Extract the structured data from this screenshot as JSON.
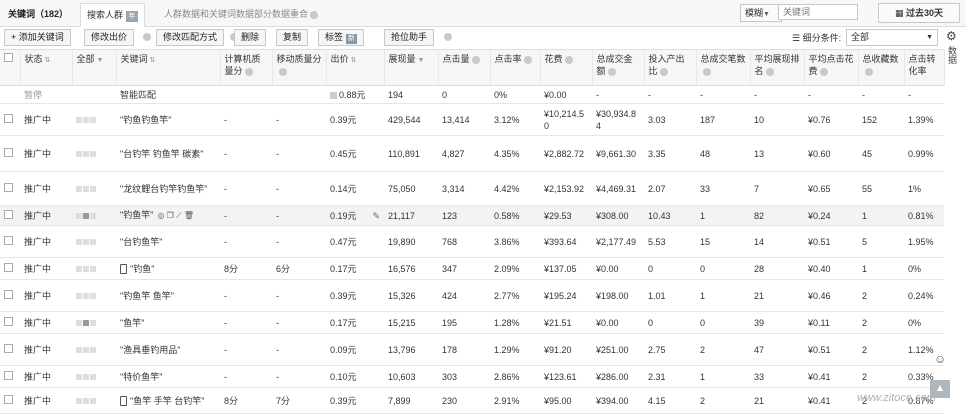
{
  "tabs": {
    "keywords": "关键词（182）",
    "search_crowd": "搜索人群",
    "badge": "年",
    "note": "人群数据和关键词数据部分数据重合"
  },
  "search": {
    "mode": "模糊",
    "placeholder": "关键词"
  },
  "date_range": "过去30天",
  "toolbar": {
    "add_keyword": "+ 添加关键词",
    "edit_price": "修改出价",
    "edit_match": "修改匹配方式",
    "delete": "删除",
    "copy": "复制",
    "tag": "标签",
    "tag_badge": "新",
    "rank_helper": "抢位助手",
    "filter_label": "细分条件:",
    "filter_value": "全部"
  },
  "side_tab": "数据",
  "columns": [
    "状态",
    "全部",
    "关键词",
    "计算机质量分",
    "移动质量分",
    "出价",
    "展现量",
    "点击量",
    "点击率",
    "花费",
    "总成交金额",
    "投入产出比",
    "总成交笔数",
    "平均展现排名",
    "平均点击花费",
    "总收藏数",
    "点击转化率"
  ],
  "rows": [
    {
      "status": "暂停",
      "kw": "智能匹配",
      "pc": "",
      "mobile": "",
      "bid": "0.88元",
      "impr": "194",
      "clicks": "0",
      "ctr": "0%",
      "cost": "¥0.00",
      "gmv": "-",
      "roi": "-",
      "orders": "-",
      "rank": "-",
      "cpc": "-",
      "fav": "-",
      "cvr": "-"
    },
    {
      "status": "推广中",
      "kw": "\"钓鱼钓鱼竿\"",
      "pc": "-",
      "mobile": "-",
      "bid": "0.39元",
      "impr": "429,544",
      "clicks": "13,414",
      "ctr": "3.12%",
      "cost": "¥10,214.50",
      "gmv": "¥30,934.84",
      "roi": "3.03",
      "orders": "187",
      "rank": "10",
      "cpc": "¥0.76",
      "fav": "152",
      "cvr": "1.39%"
    },
    {
      "status": "推广中",
      "kw": "\"台钓竿 钓鱼竿 碳素\"",
      "pc": "-",
      "mobile": "-",
      "bid": "0.45元",
      "impr": "110,891",
      "clicks": "4,827",
      "ctr": "4.35%",
      "cost": "¥2,882.72",
      "gmv": "¥9,661.30",
      "roi": "3.35",
      "orders": "48",
      "rank": "13",
      "cpc": "¥0.60",
      "fav": "45",
      "cvr": "0.99%"
    },
    {
      "status": "推广中",
      "kw": "\"龙纹鲤台钓竿钓鱼竿\"",
      "pc": "-",
      "mobile": "-",
      "bid": "0.14元",
      "impr": "75,050",
      "clicks": "3,314",
      "ctr": "4.42%",
      "cost": "¥2,153.92",
      "gmv": "¥4,469.31",
      "roi": "2.07",
      "orders": "33",
      "rank": "7",
      "cpc": "¥0.65",
      "fav": "55",
      "cvr": "1%"
    },
    {
      "status": "推广中",
      "kw": "\"钓鱼竿\"",
      "pc": "-",
      "mobile": "-",
      "bid": "0.19元",
      "impr": "21,117",
      "clicks": "123",
      "ctr": "0.58%",
      "cost": "¥29.53",
      "gmv": "¥308.00",
      "roi": "10.43",
      "orders": "1",
      "rank": "82",
      "cpc": "¥0.24",
      "fav": "1",
      "cvr": "0.81%"
    },
    {
      "status": "推广中",
      "kw": "\"台钓鱼竿\"",
      "pc": "-",
      "mobile": "-",
      "bid": "0.47元",
      "impr": "19,890",
      "clicks": "768",
      "ctr": "3.86%",
      "cost": "¥393.64",
      "gmv": "¥2,177.49",
      "roi": "5.53",
      "orders": "15",
      "rank": "14",
      "cpc": "¥0.51",
      "fav": "5",
      "cvr": "1.95%"
    },
    {
      "status": "推广中",
      "kw": "\"钓鱼\"",
      "pc": "8分",
      "mobile": "6分",
      "bid": "0.17元",
      "impr": "16,576",
      "clicks": "347",
      "ctr": "2.09%",
      "cost": "¥137.05",
      "gmv": "¥0.00",
      "roi": "0",
      "orders": "0",
      "rank": "28",
      "cpc": "¥0.40",
      "fav": "1",
      "cvr": "0%"
    },
    {
      "status": "推广中",
      "kw": "\"钓鱼竿 鱼竿\"",
      "pc": "-",
      "mobile": "-",
      "bid": "0.39元",
      "impr": "15,326",
      "clicks": "424",
      "ctr": "2.77%",
      "cost": "¥195.24",
      "gmv": "¥198.00",
      "roi": "1.01",
      "orders": "1",
      "rank": "21",
      "cpc": "¥0.46",
      "fav": "2",
      "cvr": "0.24%"
    },
    {
      "status": "推广中",
      "kw": "\"鱼竿\"",
      "pc": "-",
      "mobile": "-",
      "bid": "0.17元",
      "impr": "15,215",
      "clicks": "195",
      "ctr": "1.28%",
      "cost": "¥21.51",
      "gmv": "¥0.00",
      "roi": "0",
      "orders": "0",
      "rank": "39",
      "cpc": "¥0.11",
      "fav": "2",
      "cvr": "0%"
    },
    {
      "status": "推广中",
      "kw": "\"渔具垂钓用品\"",
      "pc": "-",
      "mobile": "-",
      "bid": "0.09元",
      "impr": "13,796",
      "clicks": "178",
      "ctr": "1.29%",
      "cost": "¥91.20",
      "gmv": "¥251.00",
      "roi": "2.75",
      "orders": "2",
      "rank": "47",
      "cpc": "¥0.51",
      "fav": "2",
      "cvr": "1.12%"
    },
    {
      "status": "推广中",
      "kw": "\"特价鱼竿\"",
      "pc": "-",
      "mobile": "-",
      "bid": "0.10元",
      "impr": "10,603",
      "clicks": "303",
      "ctr": "2.86%",
      "cost": "¥123.61",
      "gmv": "¥286.00",
      "roi": "2.31",
      "orders": "1",
      "rank": "33",
      "cpc": "¥0.41",
      "fav": "2",
      "cvr": "0.33%"
    },
    {
      "status": "推广中",
      "kw": "\"鱼竿 手竿 台钓竿\"",
      "pc": "8分",
      "mobile": "7分",
      "bid": "0.39元",
      "impr": "7,899",
      "clicks": "230",
      "ctr": "2.91%",
      "cost": "¥95.00",
      "gmv": "¥394.00",
      "roi": "4.15",
      "orders": "2",
      "rank": "21",
      "cpc": "¥0.41",
      "fav": "2",
      "cvr": "0.87%"
    }
  ],
  "watermark": "www.zitoce.com",
  "accent": "#8a96a3"
}
